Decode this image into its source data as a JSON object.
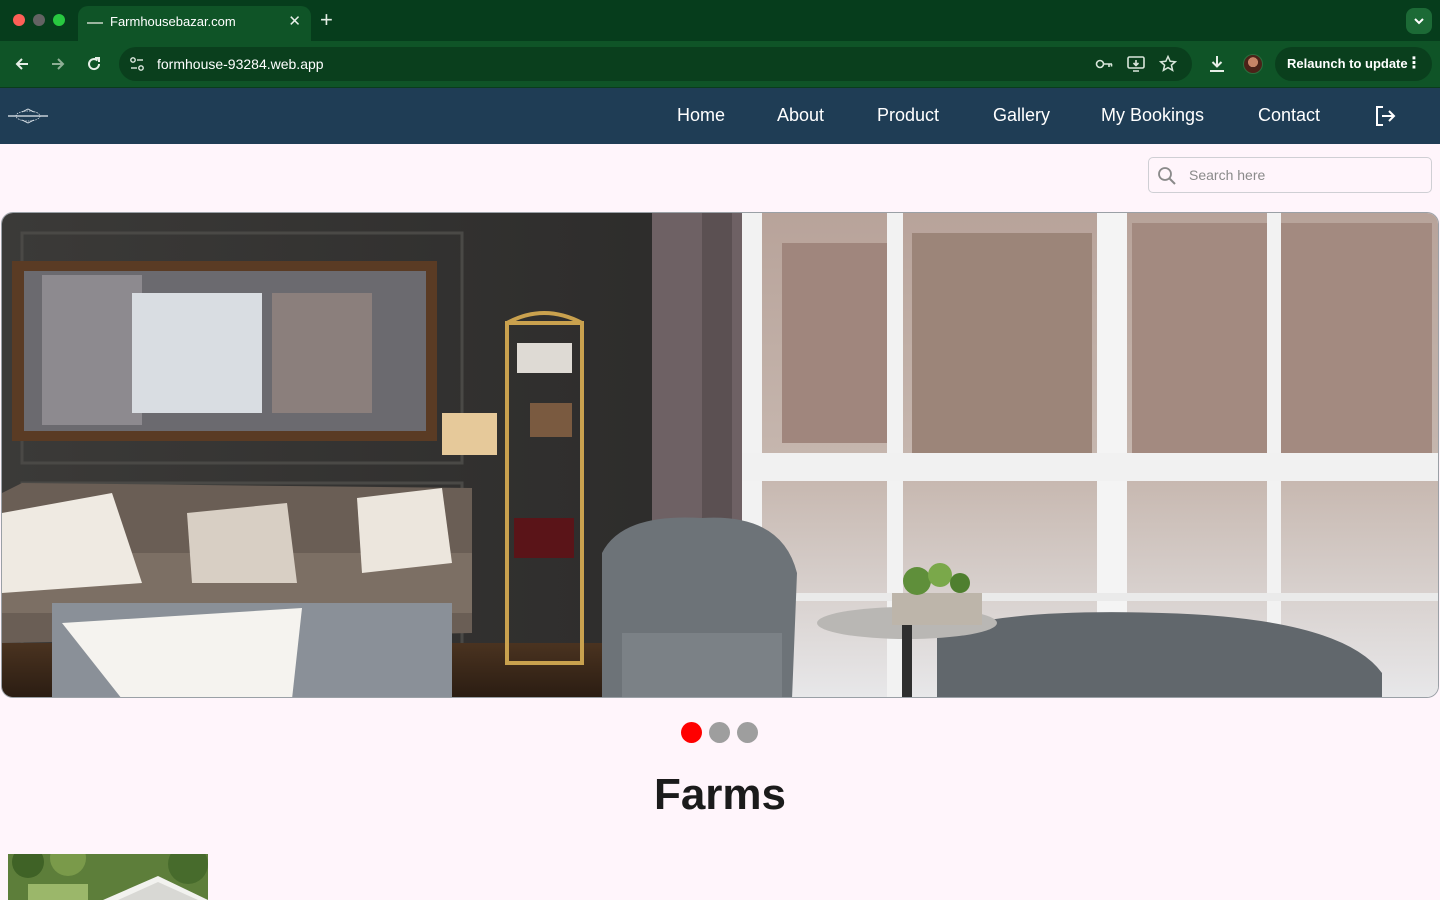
{
  "browser": {
    "tab_title": "Farmhousebazar.com",
    "tab_close_glyph": "✕",
    "new_tab_glyph": "+",
    "tab_menu_glyph": "⌄",
    "url": "formhouse-93284.web.app",
    "relaunch_label": "Relaunch to update",
    "menu_glyph": "⋮",
    "icons": [
      "back-icon",
      "forward-icon",
      "reload-icon",
      "site-info-icon",
      "password-key-icon",
      "install-app-icon",
      "bookmark-star-icon",
      "download-icon",
      "profile-avatar"
    ]
  },
  "navbar": {
    "items": [
      "Home",
      "About",
      "Product",
      "Gallery",
      "My Bookings",
      "Contact"
    ],
    "logout_icon": "logout-icon",
    "background": "#1f3d55"
  },
  "search": {
    "placeholder": "Search here"
  },
  "carousel": {
    "slide_count": 3,
    "active_index": 0,
    "active_dot_color": "#ff0000",
    "inactive_dot_color": "#9e9e9e"
  },
  "section": {
    "title": "Farms"
  },
  "colors": {
    "browser_frame": "#063d1c",
    "page_background": "#fff5fb"
  }
}
